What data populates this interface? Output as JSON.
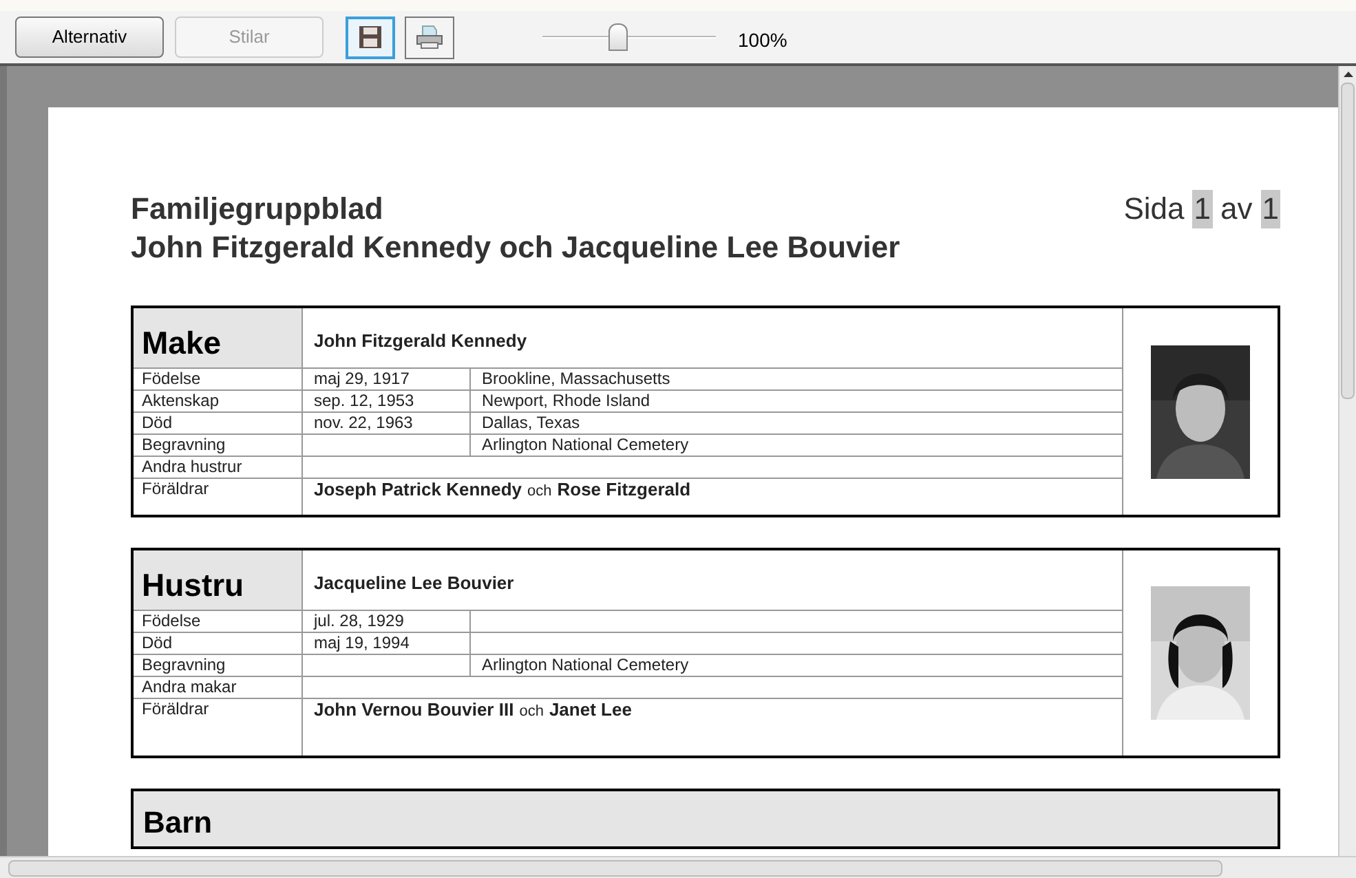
{
  "toolbar": {
    "buttons": [
      {
        "label": "Alternativ",
        "disabled": false
      },
      {
        "label": "Stilar",
        "disabled": true
      }
    ],
    "icons": [
      {
        "kind": "save",
        "selected": true
      },
      {
        "kind": "print",
        "selected": false
      }
    ],
    "zoom": {
      "level": 0.43,
      "reading": "100%"
    }
  },
  "page": {
    "title": "Familjegruppblad",
    "subtitle": "John Fitzgerald Kennedy och Jacqueline Lee Bouvier",
    "page_label": "Sida",
    "page_number": "1",
    "of_label": "av",
    "page_total": "1",
    "people": [
      {
        "role": "Make",
        "name": "John Fitzgerald Kennedy",
        "photo": {
          "kind": "picture"
        },
        "rows": [
          {
            "kind": "event",
            "label": "Födelse",
            "date": "maj 29, 1917",
            "place": "Brookline, Massachusetts"
          },
          {
            "kind": "event",
            "label": "Aktenskap",
            "date": "sep. 12, 1953",
            "place": "Newport, Rhode Island"
          },
          {
            "kind": "event",
            "label": "Död",
            "date": "nov. 22, 1963",
            "place": "Dallas, Texas"
          },
          {
            "kind": "event",
            "label": "Begravning",
            "place": "Arlington National Cemetery"
          },
          {
            "kind": "other",
            "label": "Andra hustrur"
          },
          {
            "kind": "parents",
            "label": "Föräldrar",
            "father": "Joseph Patrick Kennedy",
            "joiner": "och",
            "mother": "Rose Fitzgerald"
          }
        ]
      },
      {
        "role": "Hustru",
        "name": "Jacqueline Lee Bouvier",
        "photo": {
          "kind": "picture"
        },
        "rows": [
          {
            "kind": "event",
            "label": "Födelse",
            "date": "jul. 28, 1929"
          },
          {
            "kind": "event",
            "label": "Död",
            "date": "maj 19, 1994"
          },
          {
            "kind": "event",
            "label": "Begravning",
            "place": "Arlington National Cemetery"
          },
          {
            "kind": "other",
            "label": "Andra makar"
          },
          {
            "kind": "parents",
            "label": "Föräldrar",
            "father": "John Vernou Bouvier III",
            "joiner": "och",
            "mother": "Janet Lee",
            "tall": true
          }
        ]
      }
    ],
    "children_heading": "Barn"
  }
}
